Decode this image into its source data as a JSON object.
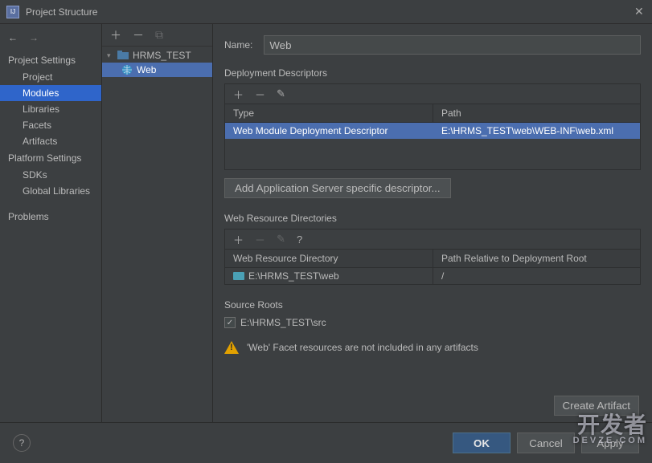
{
  "window": {
    "title": "Project Structure"
  },
  "sidebar": {
    "projectSettings": {
      "header": "Project Settings",
      "items": [
        "Project",
        "Modules",
        "Libraries",
        "Facets",
        "Artifacts"
      ],
      "selected": 1
    },
    "platformSettings": {
      "header": "Platform Settings",
      "items": [
        "SDKs",
        "Global Libraries"
      ]
    },
    "problems": "Problems"
  },
  "modules": {
    "root": {
      "label": "HRMS_TEST"
    },
    "child": {
      "label": "Web",
      "selected": true
    }
  },
  "form": {
    "nameLabel": "Name:",
    "nameValue": "Web"
  },
  "deployment": {
    "title": "Deployment Descriptors",
    "headers": {
      "type": "Type",
      "path": "Path"
    },
    "row": {
      "type": "Web Module Deployment Descriptor",
      "path": "E:\\HRMS_TEST\\web\\WEB-INF\\web.xml"
    },
    "addBtn": "Add Application Server specific descriptor..."
  },
  "webResources": {
    "title": "Web Resource Directories",
    "headers": {
      "dir": "Web Resource Directory",
      "rel": "Path Relative to Deployment Root"
    },
    "row": {
      "dir": "E:\\HRMS_TEST\\web",
      "rel": "/"
    }
  },
  "sourceRoots": {
    "title": "Source Roots",
    "item": "E:\\HRMS_TEST\\src",
    "checked": true
  },
  "warning": {
    "text": "'Web' Facet resources are not included in any artifacts",
    "button": "Create Artifact"
  },
  "footer": {
    "ok": "OK",
    "cancel": "Cancel",
    "apply": "Apply"
  },
  "watermark": {
    "cn": "开发者",
    "en": "DEVZE.COM"
  }
}
